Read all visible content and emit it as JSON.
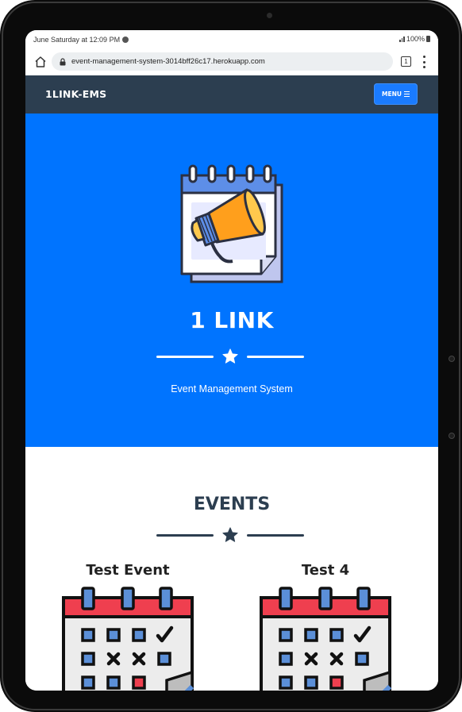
{
  "status_bar": {
    "time_text": "June Saturday at 12:09 PM",
    "battery_text": "100%"
  },
  "browser": {
    "url": "event-management-system-3014bff26c17.herokuapp.com",
    "tab_count": "1"
  },
  "navbar": {
    "brand": "1LINK-EMS",
    "menu_label": "MENU"
  },
  "hero": {
    "title": "1 LINK",
    "subtitle": "Event Management System",
    "logo_icon": "megaphone-calendar-icon"
  },
  "events": {
    "heading": "EVENTS",
    "items": [
      {
        "title": "Test Event",
        "icon": "calendar-icon"
      },
      {
        "title": "Test 4",
        "icon": "calendar-icon"
      }
    ]
  },
  "colors": {
    "navbar_bg": "#2c3e50",
    "hero_bg": "#0074ff",
    "menu_button": "#1a7bff",
    "heading_text": "#2c3e50"
  }
}
